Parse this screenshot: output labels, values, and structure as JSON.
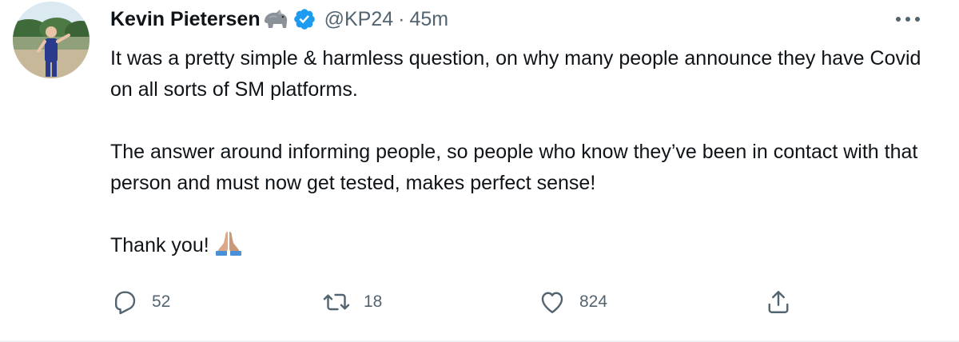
{
  "tweet": {
    "author": {
      "name": "Kevin Pietersen",
      "name_emoji": "rhino-emoji",
      "verified": true,
      "handle": "@KP24",
      "separator": "·",
      "time": "45m"
    },
    "text": {
      "paragraph_1": "It was a pretty simple & harmless question, on why many people announce they have Covid on all sorts of SM platforms.",
      "paragraph_2": "The answer around informing people, so people who know they’ve been in contact with that person and must now get tested, makes perfect sense!",
      "paragraph_3": "Thank you!",
      "paragraph_3_emoji": "folded-hands-emoji"
    },
    "actions": {
      "reply_count": "52",
      "retweet_count": "18",
      "like_count": "824"
    },
    "colors": {
      "text_primary": "#0f1419",
      "text_secondary": "#536471",
      "verified_blue": "#1d9bf0",
      "divider": "#eff3f4"
    }
  }
}
